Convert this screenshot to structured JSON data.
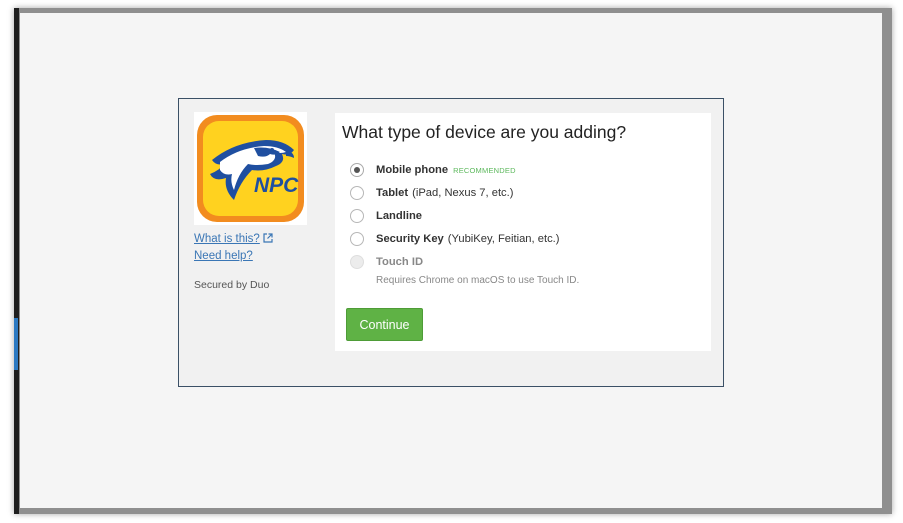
{
  "colors": {
    "accent_green": "#5fb245",
    "link_blue": "#3a76b5",
    "recommended_green": "#5cb85c",
    "logo_orange": "#f28c1f",
    "logo_yellow": "#ffd21f",
    "logo_blue": "#1f4fa0"
  },
  "sidebar": {
    "logo_text": "NPC",
    "what_is_this": "What is this?",
    "need_help": "Need help?",
    "secured_by": "Secured by Duo",
    "external_icon": "external-link-icon"
  },
  "main": {
    "title": "What type of device are you adding?",
    "options": [
      {
        "label": "Mobile phone",
        "detail": "",
        "badge": "RECOMMENDED",
        "checked": true,
        "disabled": false
      },
      {
        "label": "Tablet",
        "detail": "(iPad, Nexus 7, etc.)",
        "badge": "",
        "checked": false,
        "disabled": false
      },
      {
        "label": "Landline",
        "detail": "",
        "badge": "",
        "checked": false,
        "disabled": false
      },
      {
        "label": "Security Key",
        "detail": "(YubiKey, Feitian, etc.)",
        "badge": "",
        "checked": false,
        "disabled": false
      },
      {
        "label": "Touch ID",
        "detail": "",
        "badge": "",
        "checked": false,
        "disabled": true
      }
    ],
    "touch_id_note": "Requires Chrome on macOS to use Touch ID.",
    "continue_label": "Continue"
  }
}
